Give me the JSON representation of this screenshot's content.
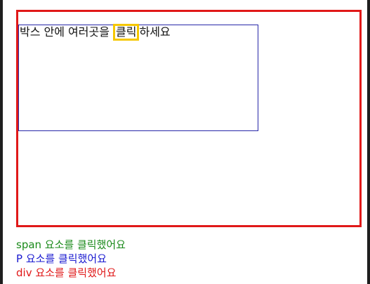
{
  "demo": {
    "paragraph_before": "박스 안에 여러곳을 ",
    "span_text": "클릭",
    "paragraph_after": "하세요"
  },
  "log": [
    {
      "text": "span 요소를 클릭했어요",
      "color": "#1a8a1a"
    },
    {
      "text": "P 요소를 클릭했어요",
      "color": "#1a1ad0"
    },
    {
      "text": "div 요소를 클릭했어요",
      "color": "#e01818"
    }
  ],
  "colors": {
    "div_border": "#e01818",
    "p_border": "#2727a8",
    "span_border": "#f5c700"
  }
}
